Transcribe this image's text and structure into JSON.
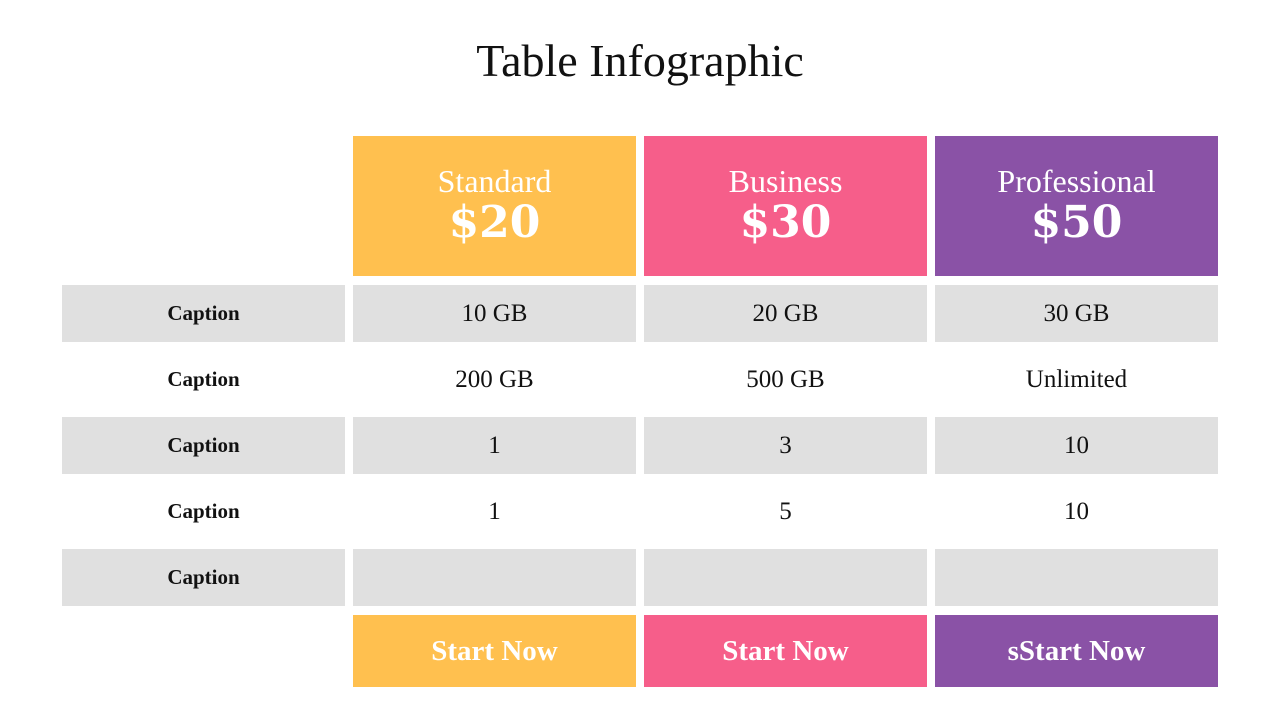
{
  "title": "Table Infographic",
  "colors": {
    "standard": "#ffc04f",
    "business": "#f65e8a",
    "professional": "#8a52a6",
    "row_grey": "#e0e0e0"
  },
  "plans": [
    {
      "name": "Standard",
      "price": "$20",
      "button": "Start Now"
    },
    {
      "name": "Business",
      "price": "$30",
      "button": "Start Now"
    },
    {
      "name": "Professional",
      "price": "$50",
      "button": "sStart Now"
    }
  ],
  "rows": [
    {
      "caption": "Caption",
      "values": [
        "10 GB",
        "20 GB",
        "30 GB"
      ]
    },
    {
      "caption": "Caption",
      "values": [
        "200 GB",
        "500 GB",
        "Unlimited"
      ]
    },
    {
      "caption": "Caption",
      "values": [
        "1",
        "3",
        "10"
      ]
    },
    {
      "caption": "Caption",
      "values": [
        "1",
        "5",
        "10"
      ]
    },
    {
      "caption": "Caption",
      "values": [
        "",
        "",
        ""
      ]
    }
  ]
}
